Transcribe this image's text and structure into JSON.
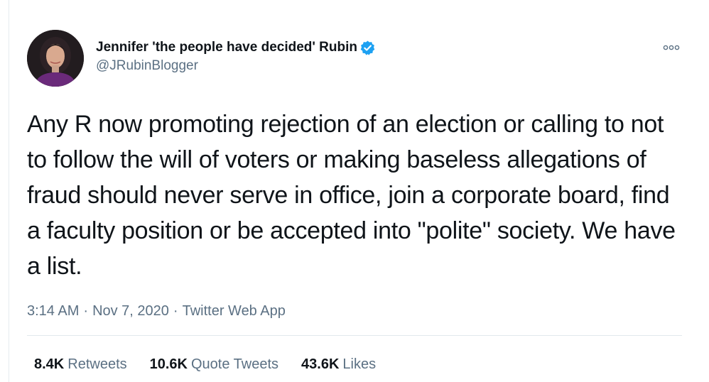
{
  "user": {
    "display_name": "Jennifer 'the people have decided' Rubin",
    "handle": "@JRubinBlogger",
    "verified_icon": "verified-badge-icon",
    "verified_color": "#1da1f2"
  },
  "tweet": {
    "text": "Any R now promoting rejection of an election or calling to not to follow the will of voters or making baseless allegations of fraud should never serve in office, join a corporate board, find a faculty position or be accepted into \"polite\" society. We have a list."
  },
  "meta": {
    "time": "3:14 AM",
    "separator": "·",
    "date": "Nov 7, 2020",
    "source": "Twitter Web App"
  },
  "stats": {
    "retweets_count": "8.4K",
    "retweets_label": "Retweets",
    "quotes_count": "10.6K",
    "quotes_label": "Quote Tweets",
    "likes_count": "43.6K",
    "likes_label": "Likes"
  },
  "colors": {
    "secondary_text": "#5b7083",
    "primary_text": "#0f1419",
    "divider": "#e1e8ed"
  }
}
